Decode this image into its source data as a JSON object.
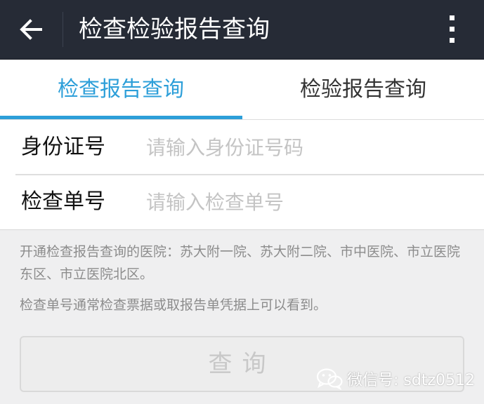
{
  "appbar": {
    "title": "检查检验报告查询",
    "back_icon": "arrow-left-icon",
    "menu_icon": "more-vertical-icon"
  },
  "tabs": [
    {
      "label": "检查报告查询",
      "active": true
    },
    {
      "label": "检验报告查询",
      "active": false
    }
  ],
  "form": {
    "id_label": "身份证号",
    "id_placeholder": "请输入身份证号码",
    "id_value": "",
    "exam_label": "检查单号",
    "exam_placeholder": "请输入检查单号",
    "exam_value": ""
  },
  "info": {
    "hospitals": "开通检查报告查询的医院：苏大附一院、苏大附二院、市中医院、市立医院东区、市立医院北区。",
    "tip": "检查单号通常检查票据或取报告单凭据上可以看到。"
  },
  "query_button": {
    "label": "查询",
    "enabled": false
  },
  "watermark": {
    "text": "微信号: sdtz0512",
    "icon": "wechat-icon"
  },
  "colors": {
    "appbar_bg": "#262b36",
    "accent": "#2d9fd9",
    "page_bg": "#efeff0"
  }
}
